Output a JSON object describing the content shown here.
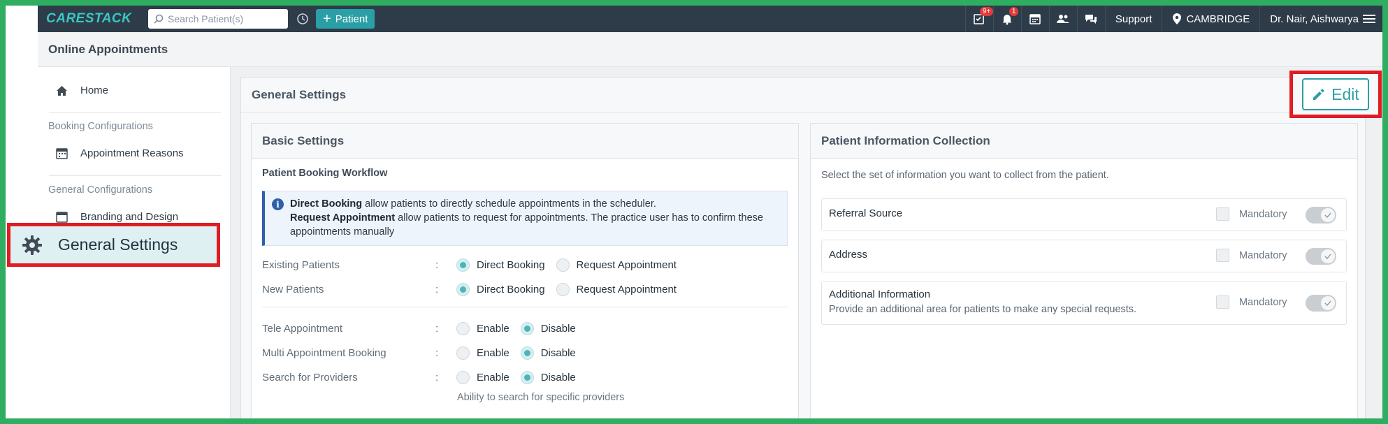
{
  "topbar": {
    "logo": "CARESTACK",
    "search_placeholder": "Search Patient(s)",
    "add_patient_label": "Patient",
    "tasks_badge": "9+",
    "notifications_badge": "1",
    "support_label": "Support",
    "location_label": "CAMBRIDGE",
    "user_label": "Dr. Nair, Aishwarya"
  },
  "page": {
    "title": "Online Appointments"
  },
  "sidebar": {
    "home": "Home",
    "group_booking": "Booking Configurations",
    "appointment_reasons": "Appointment Reasons",
    "group_general": "General Configurations",
    "branding": "Branding and Design",
    "general_settings": "General Settings"
  },
  "main": {
    "title": "General Settings",
    "edit_label": "Edit",
    "basic": {
      "title": "Basic Settings",
      "subtitle": "Patient Booking Workflow",
      "info_line1_bold": "Direct Booking",
      "info_line1_rest": " allow patients to directly schedule appointments in the scheduler.",
      "info_line2_bold": "Request Appointment",
      "info_line2_rest": " allow patients to request for appointments. The practice user has to confirm these appointments manually",
      "rows": [
        {
          "label": "Existing Patients",
          "opt1": "Direct Booking",
          "opt2": "Request Appointment",
          "selected": "opt1"
        },
        {
          "label": "New Patients",
          "opt1": "Direct Booking",
          "opt2": "Request Appointment",
          "selected": "opt1"
        },
        {
          "label": "Tele Appointment",
          "opt1": "Enable",
          "opt2": "Disable",
          "selected": "opt2"
        },
        {
          "label": "Multi Appointment Booking",
          "opt1": "Enable",
          "opt2": "Disable",
          "selected": "opt2"
        },
        {
          "label": "Search for Providers",
          "opt1": "Enable",
          "opt2": "Disable",
          "selected": "opt2"
        }
      ],
      "colon": ":",
      "providers_hint": "Ability to search for specific providers"
    },
    "pic": {
      "title": "Patient Information Collection",
      "intro": "Select the set of information you want to collect from the patient.",
      "mandatory_label": "Mandatory",
      "items": [
        {
          "title": "Referral Source",
          "desc": ""
        },
        {
          "title": "Address",
          "desc": ""
        },
        {
          "title": "Additional Information",
          "desc": "Provide an additional area for patients to make any special requests."
        }
      ]
    }
  },
  "colors": {
    "accent": "#2a9fa6",
    "topbar": "#2e3c4a",
    "highlight": "#e01c24",
    "frame": "#2fae62"
  }
}
